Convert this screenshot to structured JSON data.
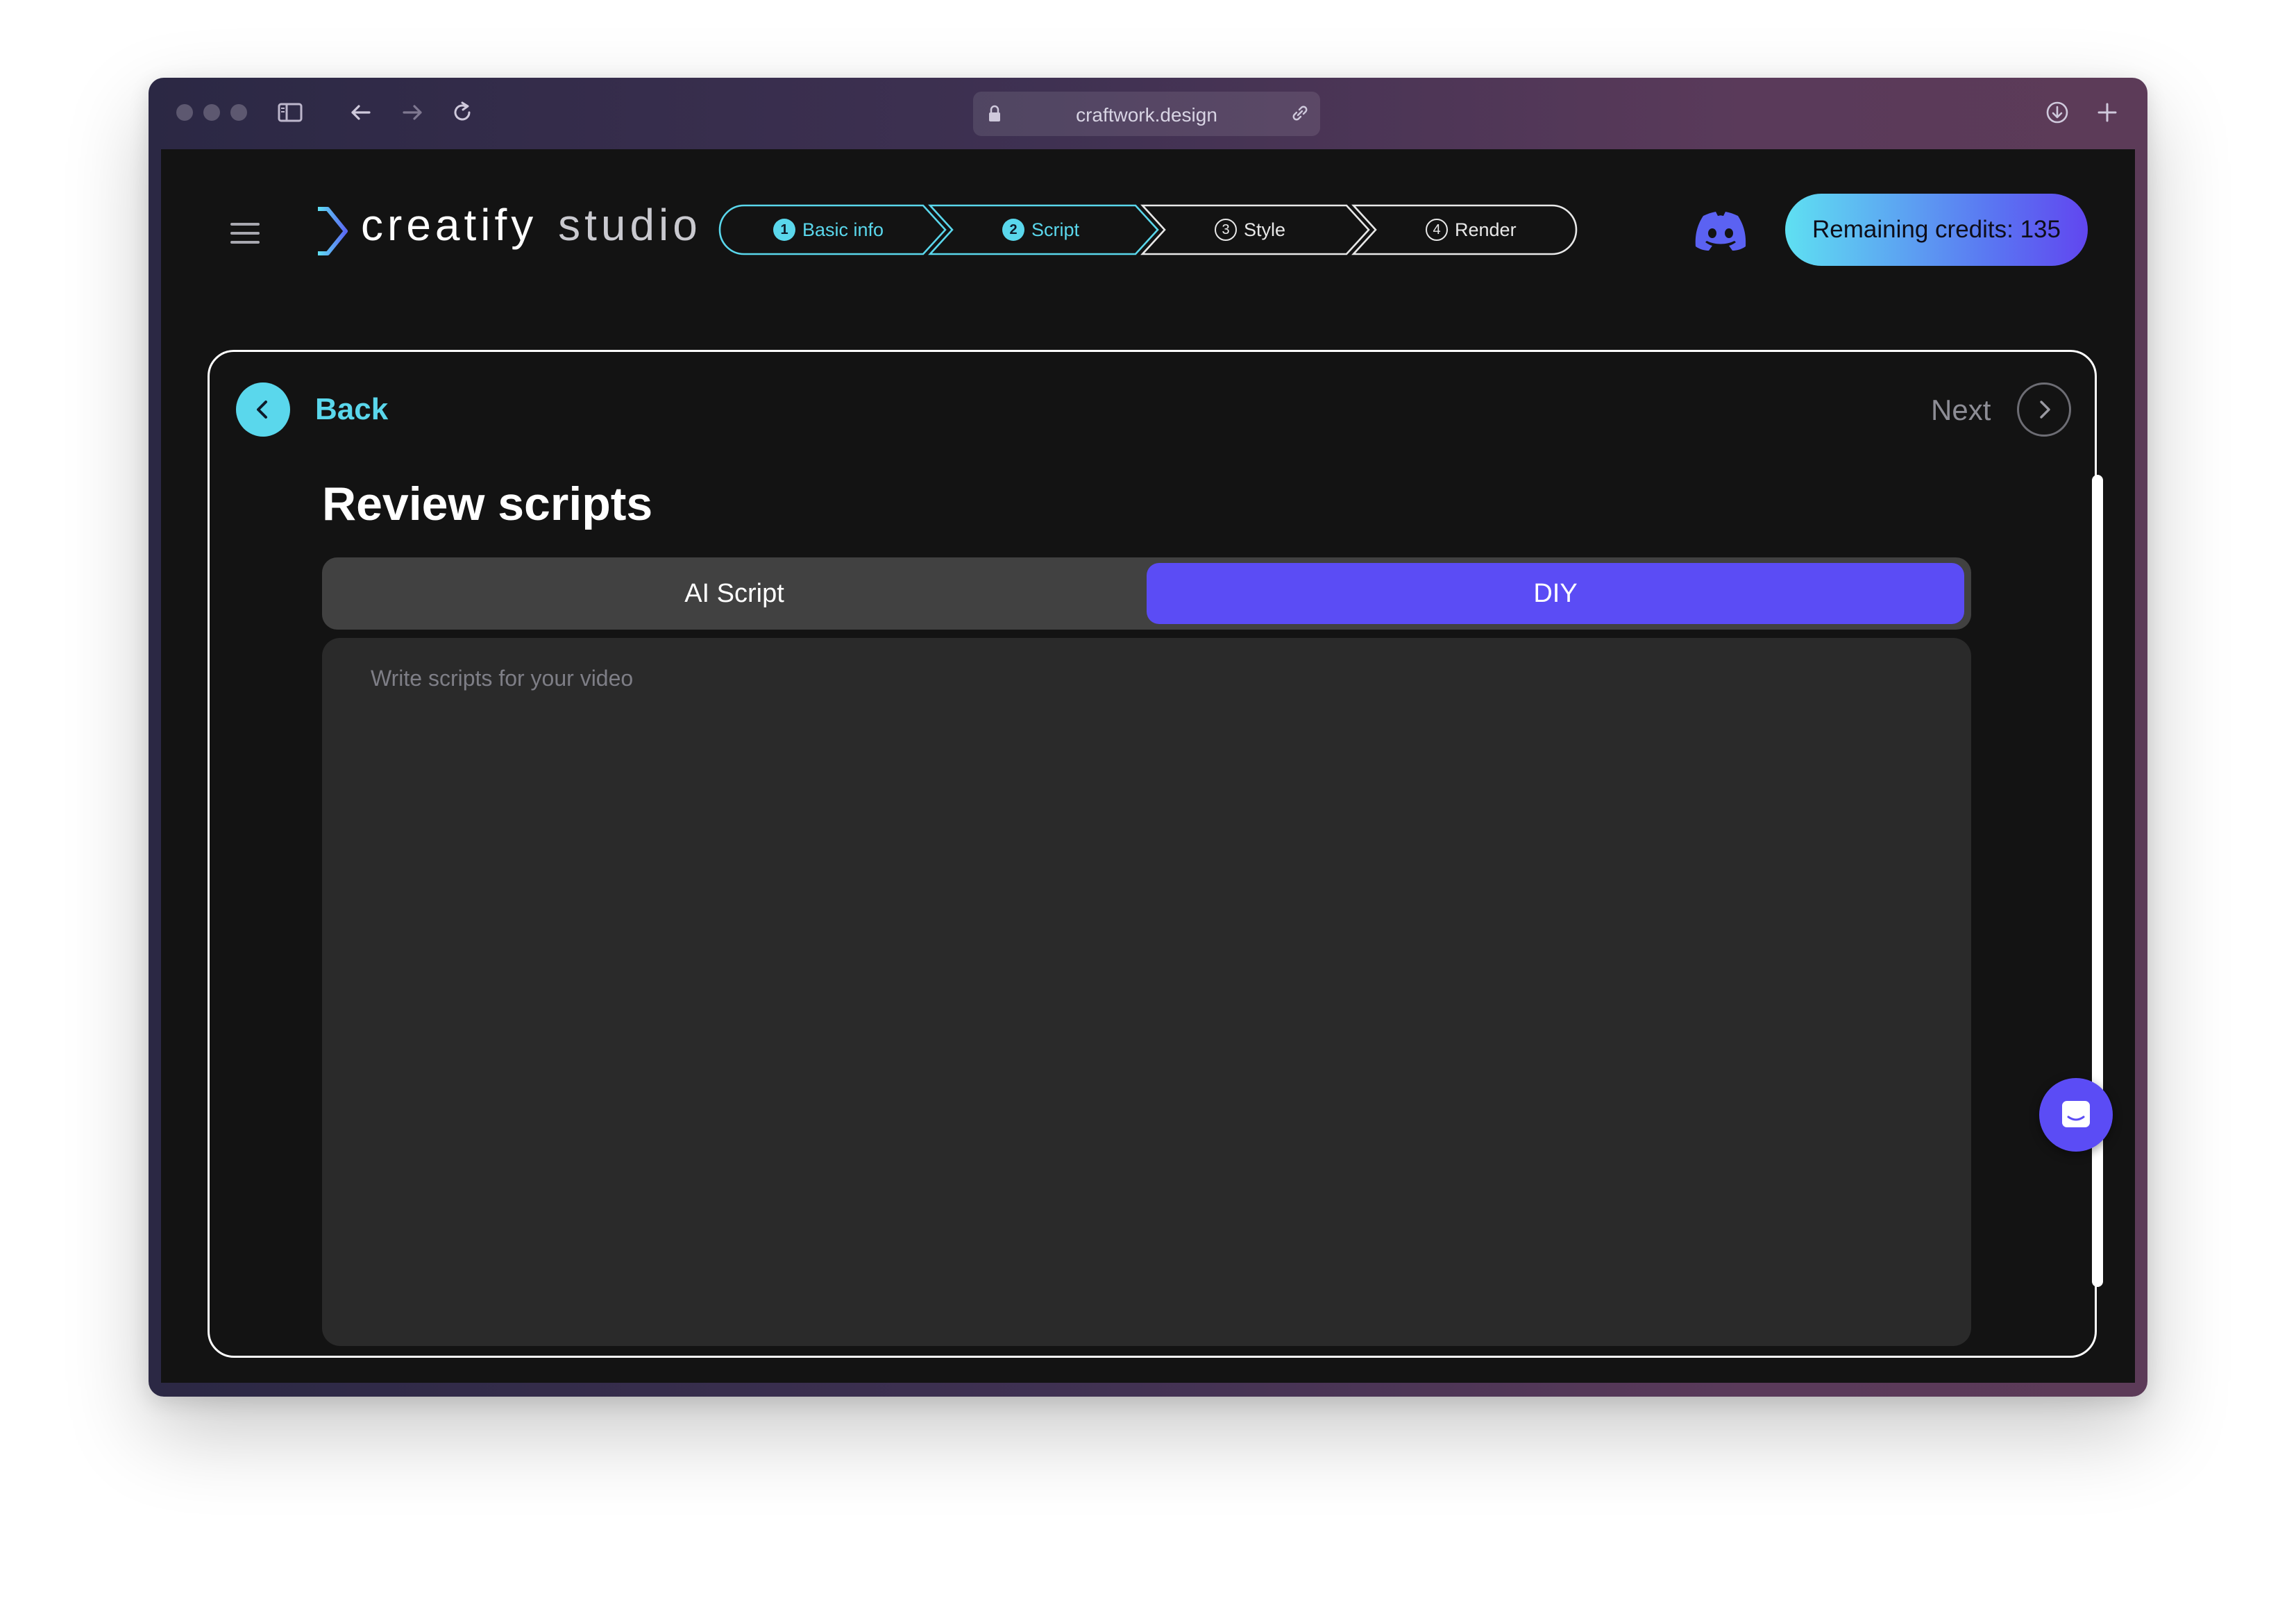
{
  "browser": {
    "url": "craftwork.design"
  },
  "app": {
    "logo_main": "creatify",
    "logo_sub": "studio"
  },
  "stepper": {
    "steps": [
      {
        "num": "1",
        "label": "Basic info",
        "state": "done"
      },
      {
        "num": "2",
        "label": "Script",
        "state": "current"
      },
      {
        "num": "3",
        "label": "Style",
        "state": "todo"
      },
      {
        "num": "4",
        "label": "Render",
        "state": "todo"
      }
    ]
  },
  "header": {
    "credits_label": "Remaining credits: 135"
  },
  "panel": {
    "back_label": "Back",
    "next_label": "Next",
    "title": "Review scripts",
    "tabs": [
      {
        "label": "AI Script",
        "selected": false
      },
      {
        "label": "DIY",
        "selected": true
      }
    ],
    "script_value": "",
    "script_placeholder": "Write scripts for your video"
  },
  "colors": {
    "accent_cyan": "#5ad7ec",
    "accent_purple": "#5b4cf5",
    "background": "#131313"
  },
  "icons": [
    "menu-icon",
    "logo-icon",
    "discord-icon",
    "chevron-left-icon",
    "chevron-right-icon",
    "chat-icon"
  ]
}
